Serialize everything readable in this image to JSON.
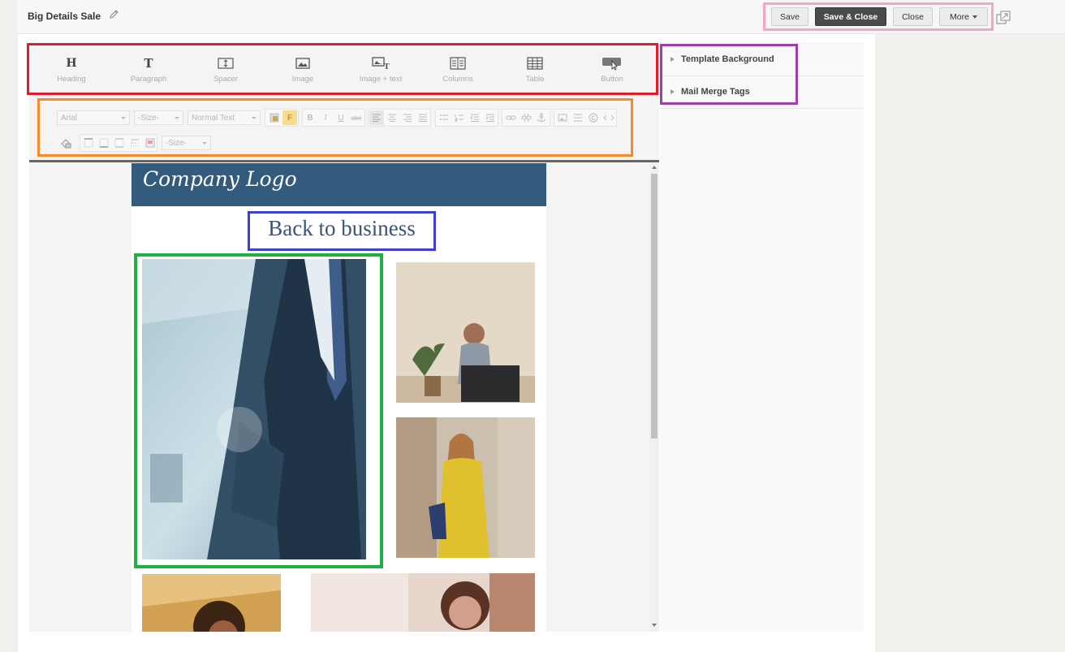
{
  "header": {
    "title": "Big Details Sale",
    "buttons": {
      "save": "Save",
      "save_close": "Save & Close",
      "close": "Close",
      "more": "More"
    }
  },
  "content_blocks": [
    {
      "label": "Heading",
      "icon": "heading-icon",
      "glyph": "H"
    },
    {
      "label": "Paragraph",
      "icon": "paragraph-icon",
      "glyph": "T"
    },
    {
      "label": "Spacer",
      "icon": "spacer-icon"
    },
    {
      "label": "Image",
      "icon": "image-icon"
    },
    {
      "label": "Image + text",
      "icon": "image-text-icon"
    },
    {
      "label": "Columns",
      "icon": "columns-icon"
    },
    {
      "label": "Table",
      "icon": "table-icon"
    },
    {
      "label": "Button",
      "icon": "button-icon"
    }
  ],
  "format_toolbar": {
    "font_family": "Arial",
    "font_size": "-Size-",
    "text_style": "Normal Text",
    "border_size": "-Size-",
    "glyphs": {
      "bold": "B",
      "italic": "I",
      "underline": "U",
      "strike": "abc",
      "font_color": "F"
    }
  },
  "email": {
    "logo_text": "Company Logo",
    "heading": "Back to business"
  },
  "right_panel": {
    "sections": [
      "Template Background",
      "Mail Merge Tags"
    ]
  },
  "colors": {
    "header_bg": "#335b7d",
    "primary_button": "#4a4a4a",
    "heading_text": "#3b5376",
    "highlight_red": "#e01e2b",
    "highlight_orange": "#f7892b",
    "highlight_pink": "#f5a6c7",
    "highlight_purple": "#9b42a8",
    "highlight_blue": "#3b3fcb",
    "highlight_green": "#1eb040"
  }
}
